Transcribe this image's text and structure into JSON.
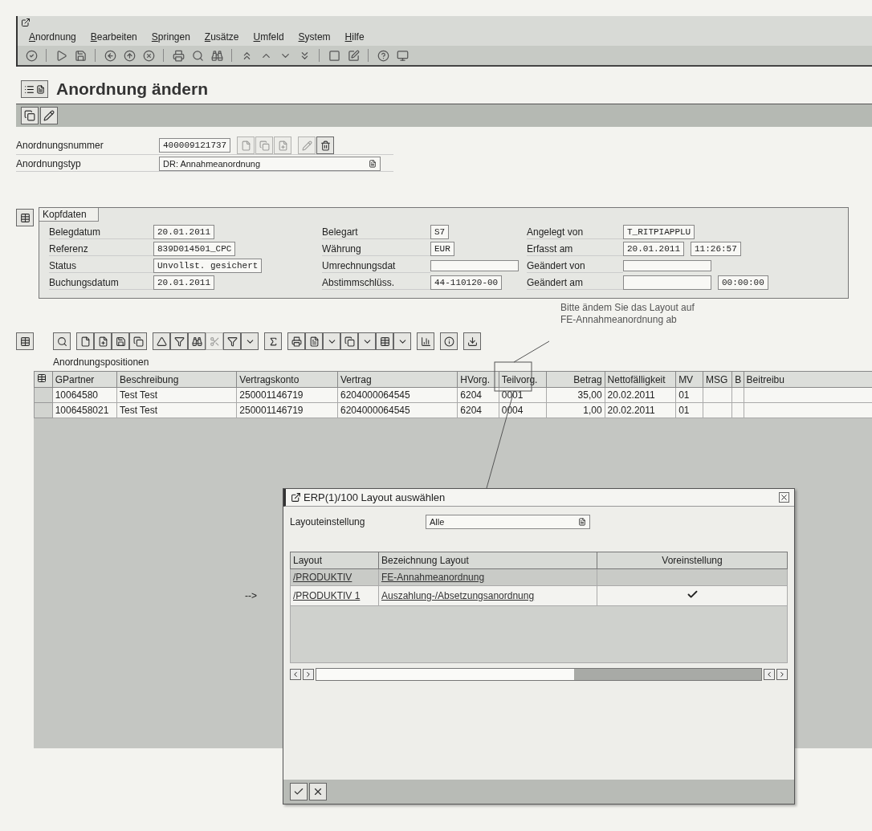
{
  "menu": [
    "Anordnung",
    "Bearbeiten",
    "Springen",
    "Zusätze",
    "Umfeld",
    "System",
    "Hilfe"
  ],
  "title": "Anordnung ändern",
  "fields": [
    {
      "label": "Anordnungsnummer",
      "value": "400009121737",
      "kind": "input"
    },
    {
      "label": "Anordnungstyp",
      "value": "DR: Annahmeanordnung",
      "kind": "dropdown"
    }
  ],
  "header": {
    "title": "Kopfdaten",
    "fields": [
      {
        "label": "Belegdatum",
        "values": [
          "20.01.2011"
        ]
      },
      {
        "label": "Belegart",
        "values": [
          "S7"
        ]
      },
      {
        "label": "Angelegt von",
        "values": [
          "T_RITPIAPPLU"
        ]
      },
      {
        "label": "Referenz",
        "values": [
          "839D014501_CPC"
        ]
      },
      {
        "label": "Währung",
        "values": [
          "EUR"
        ]
      },
      {
        "label": "Erfasst am",
        "values": [
          "20.01.2011",
          "11:26:57"
        ]
      },
      {
        "label": "Status",
        "values": [
          "Unvollst. gesichert"
        ]
      },
      {
        "label": "Umrechnungsdat",
        "blank": true
      },
      {
        "label": "Geändert von",
        "blank": true
      },
      {
        "label": "Buchungsdatum",
        "values": [
          "20.01.2011"
        ]
      },
      {
        "label": "Abstimmschlüss.",
        "values": [
          "44-110120-00"
        ]
      },
      {
        "label": "Geändert am",
        "blank": true,
        "values": [
          "00:00:00"
        ]
      }
    ]
  },
  "annotation": [
    "Bitte ändem Sie das Layout auf",
    "FE-Annahmeanordnung ab"
  ],
  "positions": {
    "title": "Anordnungspositionen",
    "columns": [
      "GPartner",
      "Beschreibung",
      "Vertragskonto",
      "Vertrag",
      "HVorg.",
      "Teilvorg.",
      "Betrag",
      "Nettofälligkeit",
      "MV",
      "MSG",
      "B",
      "Beitreibu"
    ],
    "rows": [
      {
        "cells": [
          "10064580",
          "Test Test",
          "250001146719",
          "6204000064545",
          "6204",
          "0001",
          "35,00",
          "20.02.2011",
          "01",
          "",
          "",
          ""
        ]
      },
      {
        "cells": [
          "1006458021",
          "Test Test",
          "250001146719",
          "6204000064545",
          "6204",
          "0004",
          "1,00",
          "20.02.2011",
          "01",
          "",
          "",
          ""
        ]
      }
    ]
  },
  "dialog": {
    "title": "ERP(1)/100 Layout auswählen",
    "marker": "-->",
    "setting": {
      "label": "Layouteinstellung",
      "value": "Alle"
    },
    "columns": [
      "Layout",
      "Bezeichnung Layout",
      "Voreinstellung"
    ],
    "rows": [
      {
        "layout": "/PRODUKTIV",
        "name": "FE-Annahmeanordnung",
        "default": false,
        "selected": true
      },
      {
        "layout": "/PRODUKTIV 1",
        "name": "Auszahlung-/Absetzungsanordnung",
        "default": true,
        "selected": false
      }
    ]
  }
}
